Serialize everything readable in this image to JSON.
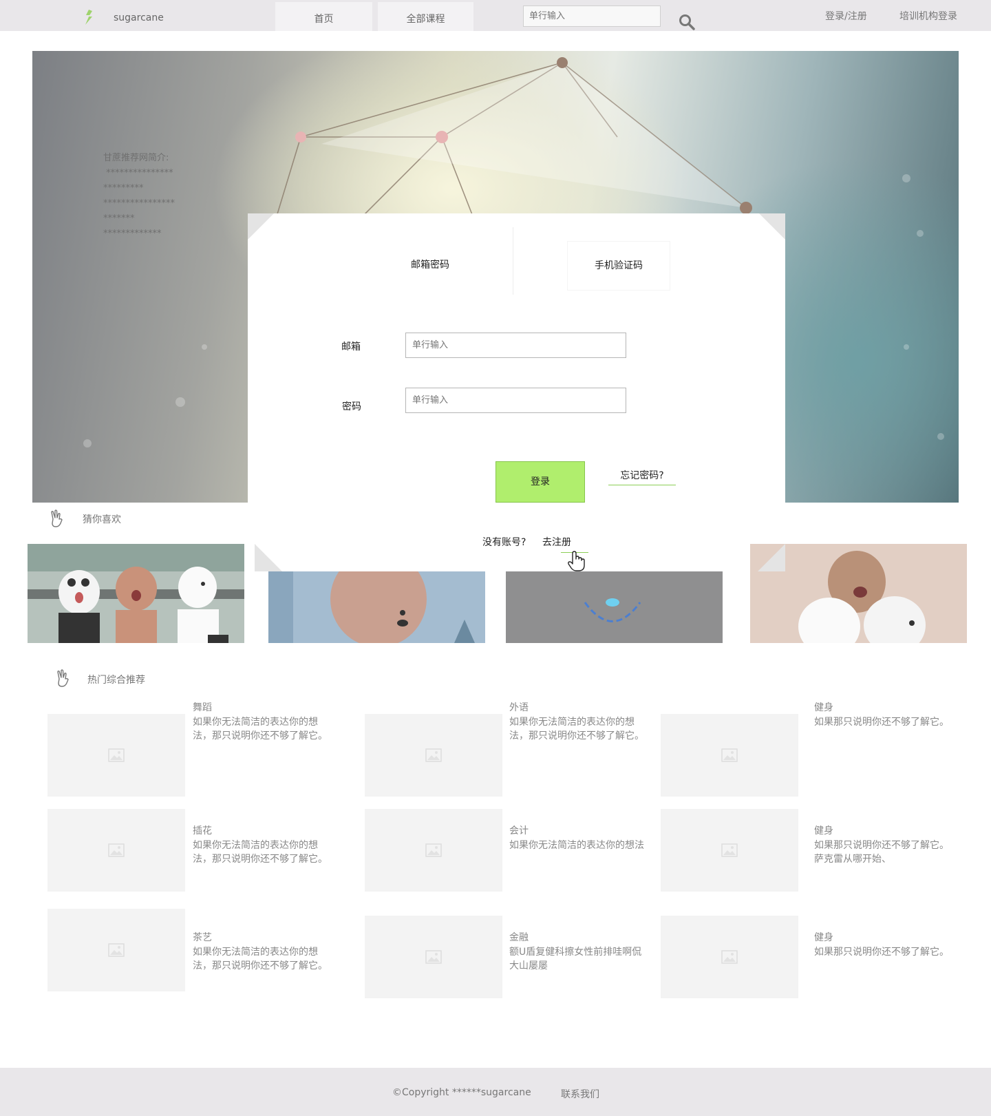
{
  "header": {
    "logo_text": "sugarcane",
    "tabs": [
      {
        "label": "首页"
      },
      {
        "label": "全部课程"
      }
    ],
    "search_placeholder": "单行输入",
    "links": [
      {
        "label": "登录/注册"
      },
      {
        "label": "培训机构登录"
      }
    ]
  },
  "hero": {
    "intro_lines": [
      "甘蔗推荐网简介:",
      " ***************",
      "*********",
      "****************",
      "*******",
      "*************"
    ]
  },
  "login": {
    "tabs": [
      {
        "label": "邮箱密码"
      },
      {
        "label": "手机验证码"
      }
    ],
    "email_label": "邮箱",
    "email_placeholder": "单行输入",
    "password_label": "密码",
    "password_placeholder": "单行输入",
    "submit_label": "登录",
    "forgot_label": "忘记密码?",
    "no_account_label": "没有账号?",
    "register_label": "去注册",
    "accent_color": "#b0ee6d"
  },
  "sections": {
    "guess_title": "猜你喜欢",
    "hot_title": "热门综合推荐"
  },
  "hot_cards": [
    {
      "title": "舞蹈",
      "desc": [
        "如果你无法简洁的表达你的想",
        "法，那只说明你还不够了解它。"
      ]
    },
    {
      "title": "外语",
      "desc": [
        "如果你无法简洁的表达你的想",
        "法，那只说明你还不够了解它。"
      ]
    },
    {
      "title": "健身",
      "desc": [
        "如果那只说明你还不够了解它。"
      ]
    },
    {
      "title": "插花",
      "desc": [
        "如果你无法简洁的表达你的想",
        "法，那只说明你还不够了解它。"
      ]
    },
    {
      "title": "会计",
      "desc": [
        "如果你无法简洁的表达你的想法"
      ]
    },
    {
      "title": "健身",
      "desc": [
        "如果那只说明你还不够了解它。",
        "萨克雷从哪开始、"
      ]
    },
    {
      "title": "茶艺",
      "desc": [
        "如果你无法简洁的表达你的想",
        "法，那只说明你还不够了解它。"
      ]
    },
    {
      "title": "金融",
      "desc": [
        "额U盾复健科擦女性前排哇啊侃",
        "大山屡屡"
      ]
    },
    {
      "title": "健身",
      "desc": [
        "如果那只说明你还不够了解它。"
      ]
    }
  ],
  "footer": {
    "copyright": "©Copyright ******sugarcane",
    "contact": "联系我们"
  }
}
